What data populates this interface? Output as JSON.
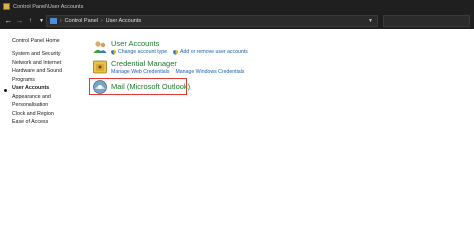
{
  "window": {
    "title": "Control Panel\\User Accounts"
  },
  "addressbar": {
    "back_icon": "back-arrow-icon",
    "breadcrumb": [
      "Control Panel",
      "User Accounts"
    ]
  },
  "leftnav": {
    "items": [
      "Control Panel Home",
      "System and Security",
      "Network and Internet",
      "Hardware and Sound",
      "Programs",
      "User Accounts",
      "Appearance and Personalisation",
      "Clock and Region",
      "Ease of Access"
    ],
    "appearance_line1": "Appearance and",
    "appearance_line2": "Personalisation",
    "active": "User Accounts"
  },
  "categories": {
    "user_accounts": {
      "title": "User Accounts",
      "links": [
        "Change account type",
        "Add or remove user accounts"
      ]
    },
    "credential_manager": {
      "title": "Credential Manager",
      "links": [
        "Manage Web Credentials",
        "Manage Windows Credentials"
      ]
    },
    "mail": {
      "title": "Mail (Microsoft Outlook)"
    }
  },
  "colors": {
    "category_title": "#1e7a2e",
    "link": "#1f5fa8",
    "highlight": "#e53935",
    "titlebar": "#1f1f1f"
  }
}
